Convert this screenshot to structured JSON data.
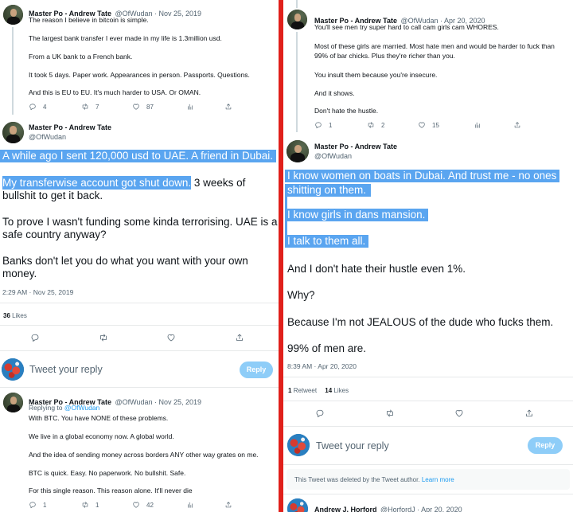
{
  "left": {
    "tweet1": {
      "name": "Master Po - Andrew Tate",
      "handle_date": "@OfWudan · Nov 25, 2019",
      "lines": [
        "The reason I believe in bitcoin is simple.",
        "The largest bank transfer I ever made in my life is 1.3million usd.",
        "From a UK bank to a French bank.",
        "It took 5 days. Paper work. Appearances in person. Passports. Questions.",
        "And this is EU to EU. It's much harder to USA. Or OMAN."
      ],
      "replies": "4",
      "retweets": "7",
      "likes": "87"
    },
    "main": {
      "name": "Master Po - Andrew Tate",
      "handle": "@OfWudan",
      "line1": "A while ago I sent 120,000 usd to UAE. A friend in Dubai.",
      "line2_hl": "My transferwise account got shut down.",
      "line2_rest": " 3 weeks of",
      "line3": "bullshit to get it back.",
      "line4": "To prove I wasn't funding some kinda terrorising. UAE is a",
      "line5": "safe country anyway?",
      "line6": "Banks don't let you do what you want with your own",
      "line7": "money.",
      "timestamp": "2:29 AM · Nov 25, 2019",
      "likes_count": "36",
      "likes_label": "Likes"
    },
    "composer": {
      "placeholder": "Tweet your reply",
      "button": "Reply"
    },
    "tweet3": {
      "name": "Master Po - Andrew Tate",
      "handle_date": "@OfWudan · Nov 25, 2019",
      "replying_to": "Replying to",
      "replying_handle": "@OfWudan",
      "lines": [
        "With BTC. You have NONE of these problems.",
        "We live in a global economy now. A global world.",
        "And the idea of sending money across borders ANY other way grates on me.",
        "BTC is quick. Easy. No paperwork. No bullshit. Safe.",
        "For this single reason. This reason alone. It'll never die"
      ],
      "replies": "1",
      "retweets": "1",
      "likes": "42"
    }
  },
  "right": {
    "tweet1": {
      "name": "Master Po - Andrew Tate",
      "handle_date": "@OfWudan · Apr 20, 2020",
      "lines": [
        "You'll see men try super hard to call cam girls cam WHORES.",
        "Most of these girls are married. Most hate men and would be harder to fuck than",
        "99% of bar chicks. Plus they're richer than you.",
        "You insult them because you're insecure.",
        "And it shows.",
        "Don't hate the hustle."
      ],
      "replies": "1",
      "retweets": "2",
      "likes": "15"
    },
    "main": {
      "name": "Master Po - Andrew Tate",
      "handle": "@OfWudan",
      "line1": "I know women on boats in Dubai. And trust me - no ones",
      "line2": "shitting on them.",
      "line3": "I know girls in dans mansion.",
      "line4": "I talk to them all.",
      "line5": "And I don't hate their hustle even 1%.",
      "line6": "Why?",
      "line7": "Because I'm not JEALOUS of the dude who fucks them.",
      "line8": "99% of men are.",
      "timestamp": "8:39 AM · Apr 20, 2020",
      "retweets_count": "1",
      "retweets_label": "Retweet",
      "likes_count": "14",
      "likes_label": "Likes"
    },
    "composer": {
      "placeholder": "Tweet your reply",
      "button": "Reply"
    },
    "deleted": {
      "text": "This Tweet was deleted by the Tweet author.",
      "link": "Learn more"
    },
    "tweet_next": {
      "name": "Andrew J. Horford",
      "handle_date": "@HorfordJ · Apr 20, 2020"
    }
  },
  "colors": {
    "highlight": "#5aa5f0",
    "divider": "#e0201b",
    "link": "#1d9bf0",
    "reply_button": "#8ecdf8"
  }
}
